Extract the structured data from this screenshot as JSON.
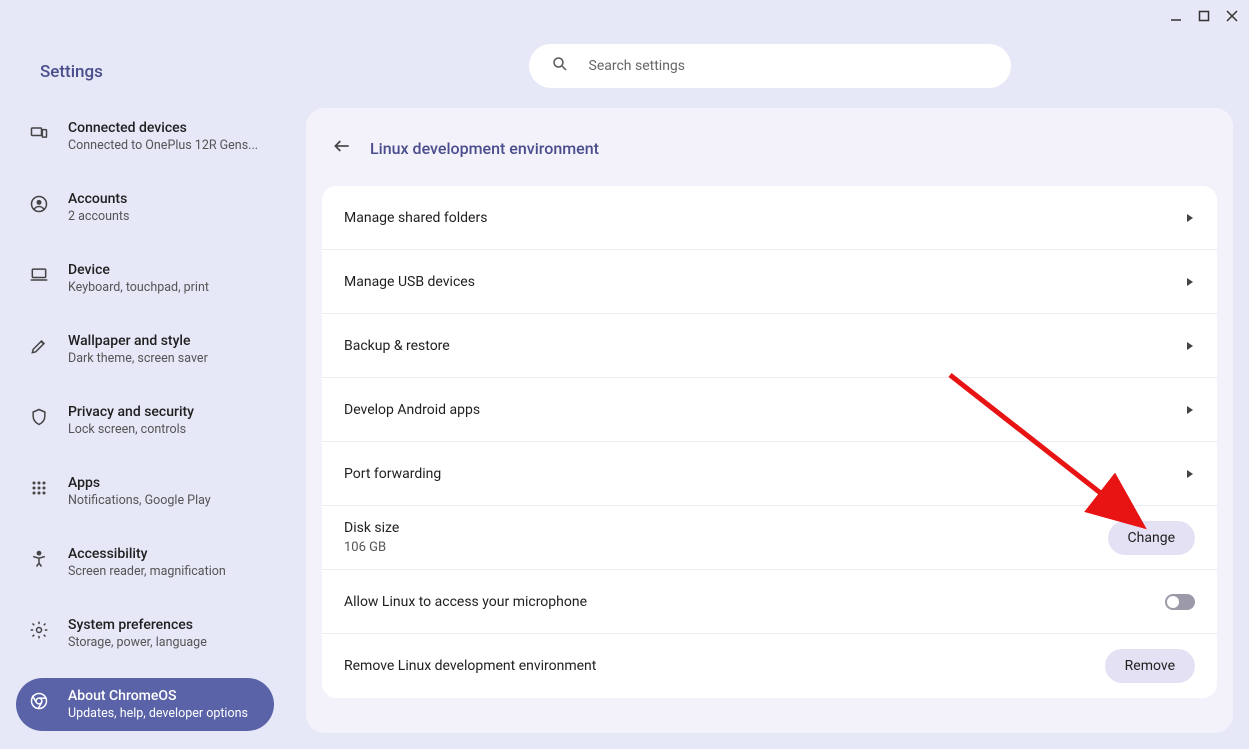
{
  "app_title": "Settings",
  "search": {
    "placeholder": "Search settings"
  },
  "sidebar": {
    "items": [
      {
        "label": "Connected devices",
        "sub": "Connected to OnePlus 12R Gens..."
      },
      {
        "label": "Accounts",
        "sub": "2 accounts"
      },
      {
        "label": "Device",
        "sub": "Keyboard, touchpad, print"
      },
      {
        "label": "Wallpaper and style",
        "sub": "Dark theme, screen saver"
      },
      {
        "label": "Privacy and security",
        "sub": "Lock screen, controls"
      },
      {
        "label": "Apps",
        "sub": "Notifications, Google Play"
      },
      {
        "label": "Accessibility",
        "sub": "Screen reader, magnification"
      },
      {
        "label": "System preferences",
        "sub": "Storage, power, language"
      },
      {
        "label": "About ChromeOS",
        "sub": "Updates, help, developer options"
      }
    ]
  },
  "page": {
    "title": "Linux development environment",
    "rows": {
      "shared_folders": "Manage shared folders",
      "usb": "Manage USB devices",
      "backup": "Backup & restore",
      "android": "Develop Android apps",
      "port": "Port forwarding",
      "disk_label": "Disk size",
      "disk_value": "106 GB",
      "change_btn": "Change",
      "mic": "Allow Linux to access your microphone",
      "remove_label": "Remove Linux development environment",
      "remove_btn": "Remove"
    }
  }
}
